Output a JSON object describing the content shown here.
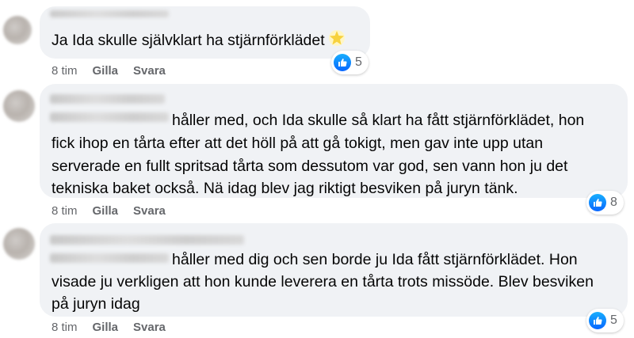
{
  "comments": [
    {
      "text_lines": [
        "Ja Ida skulle självklart ha stjärnförklädet"
      ],
      "emoji": "star-sparkle",
      "time": "8 tim",
      "like_label": "Gilla",
      "reply_label": "Svara",
      "reaction_count": "5"
    },
    {
      "text_lines": [
        "håller med, och Ida skulle så klart ha fått stjärnförklädet, hon",
        "fick ihop en tårta efter att det höll på att gå tokigt, men gav inte upp utan",
        "serverade en fullt spritsad tårta som dessutom var god, sen vann hon ju det",
        "tekniska baket också. Nä idag blev jag riktigt besviken på juryn tänk."
      ],
      "time": "8 tim",
      "like_label": "Gilla",
      "reply_label": "Svara",
      "reaction_count": "8"
    },
    {
      "text_lines": [
        "håller med dig och sen borde ju Ida fått stjärnförklädet. Hon",
        "visade ju verkligen att hon kunde leverera en tårta trots missöde. Blev besviken",
        "på juryn idag"
      ],
      "time": "8 tim",
      "like_label": "Gilla",
      "reply_label": "Svara",
      "reaction_count": "5"
    }
  ],
  "colors": {
    "bubble": "#f0f2f5",
    "text": "#050505",
    "meta": "#65676b",
    "like_blue": "#0866ff"
  },
  "icons": {
    "reaction": "like-thumbs-up-icon"
  }
}
